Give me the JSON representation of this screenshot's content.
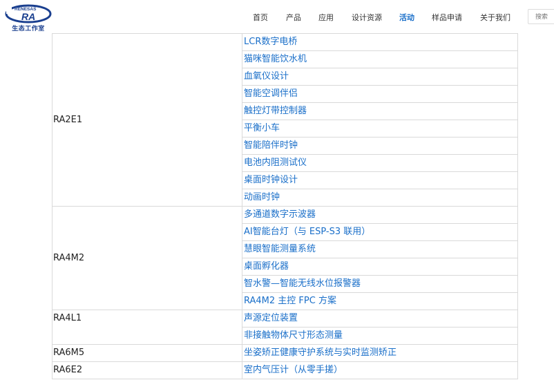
{
  "header": {
    "logo": {
      "brand_top": "RENESAS",
      "brand_mark": "RA",
      "brand_sub": "生态工作室"
    },
    "nav": [
      {
        "label": "首页",
        "active": false
      },
      {
        "label": "产品",
        "active": false
      },
      {
        "label": "应用",
        "active": false
      },
      {
        "label": "设计资源",
        "active": false
      },
      {
        "label": "活动",
        "active": true
      },
      {
        "label": "样品申请",
        "active": false
      },
      {
        "label": "关于我们",
        "active": false
      }
    ],
    "search": {
      "placeholder": "搜索"
    }
  },
  "colors": {
    "link": "#1a6fc9",
    "logo_blue": "#1a3f8f",
    "border": "#d9d9d9"
  },
  "table": {
    "groups": [
      {
        "chip": "RA2E1",
        "projects": [
          "LCR数字电桥",
          "猫咪智能饮水机",
          "血氧仪设计",
          "智能空调伴侣",
          "触控灯带控制器",
          "平衡小车",
          "智能陪伴时钟",
          "电池内阻测试仪",
          "桌面时钟设计",
          "动画时钟"
        ]
      },
      {
        "chip": "RA4M2",
        "projects": [
          "多通道数字示波器",
          "AI智能台灯（与 ESP-S3 联用）",
          "慧眼智能测量系统",
          "桌面孵化器",
          "智水警—智能无线水位报警器",
          "RA4M2 主控 FPC 方案"
        ]
      },
      {
        "chip": "RA4L1",
        "projects": [
          "声源定位装置",
          "非接触物体尺寸形态测量"
        ]
      },
      {
        "chip": "RA6M5",
        "projects": [
          "坐姿矫正健康守护系统与实时监测矫正"
        ]
      },
      {
        "chip": "RA6E2",
        "projects": [
          "室内气压计（从零手搓）"
        ]
      }
    ]
  }
}
